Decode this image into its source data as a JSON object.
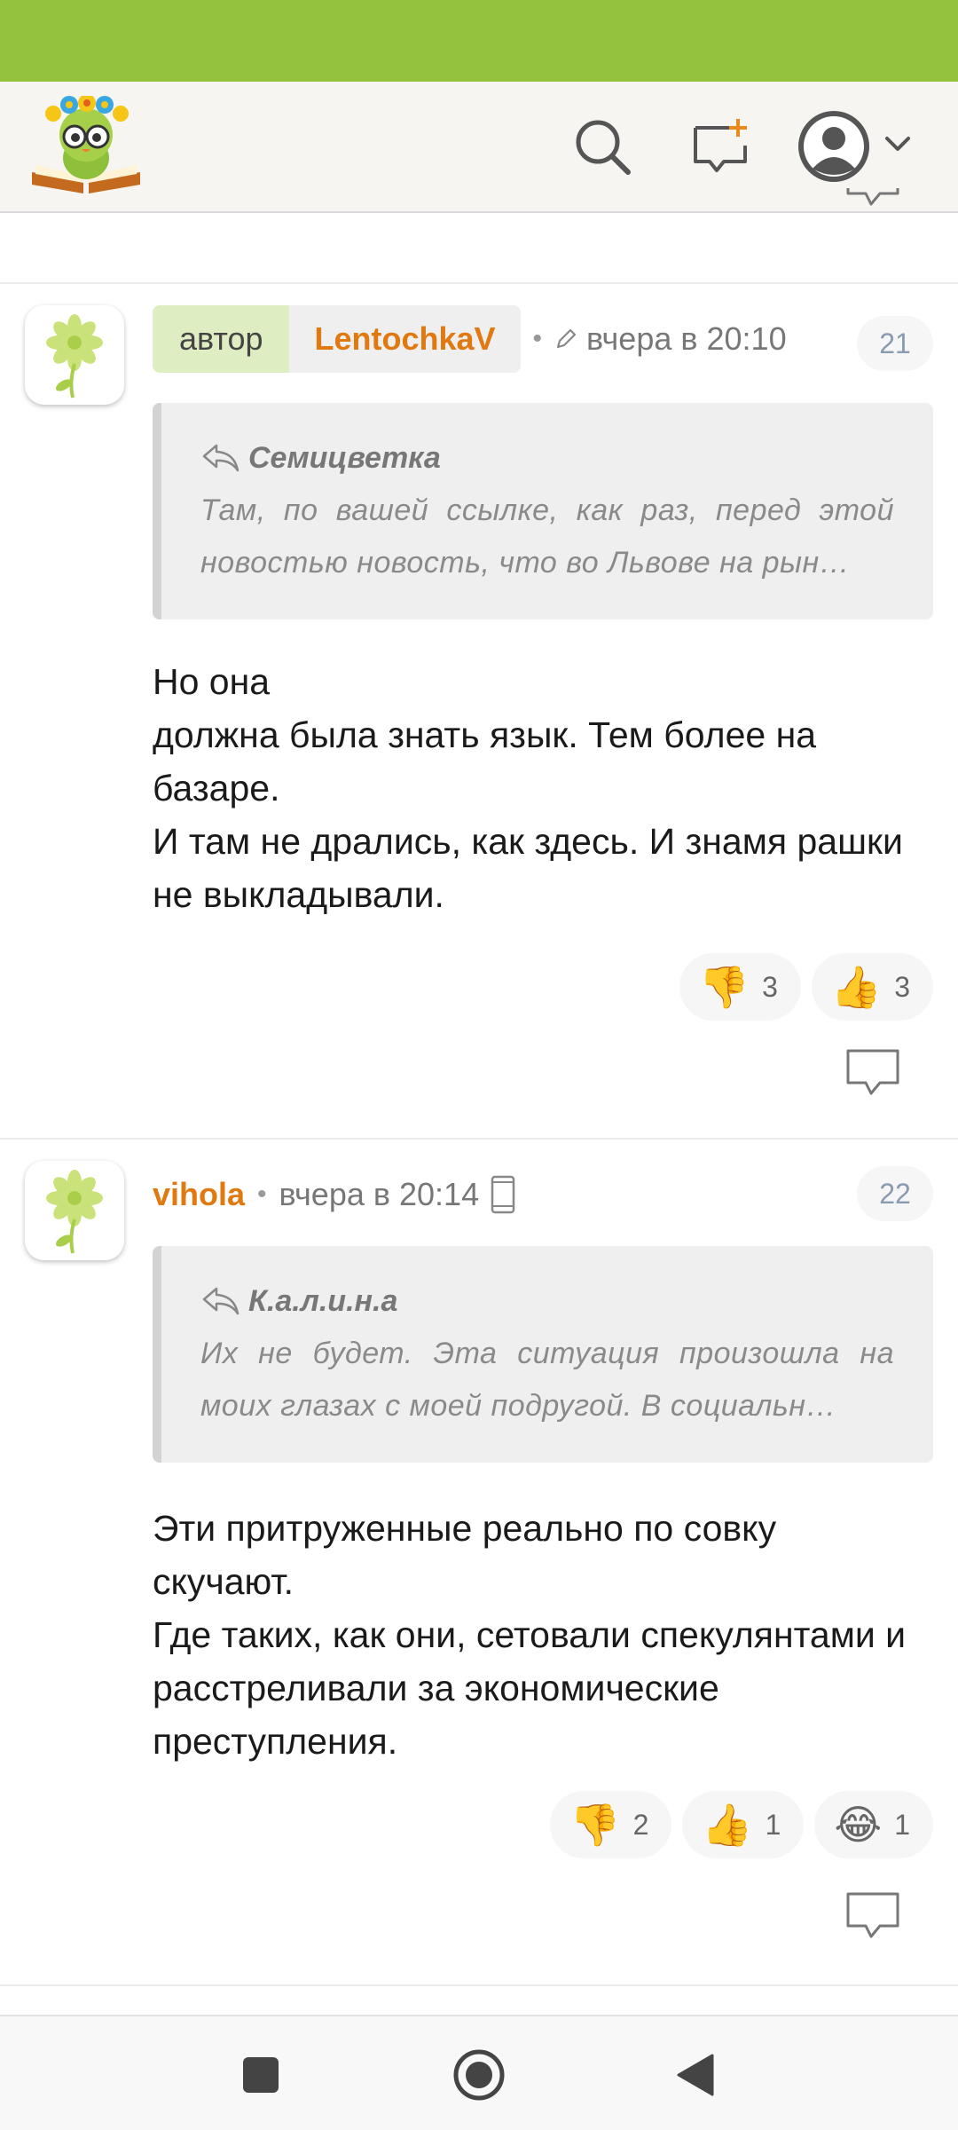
{
  "header": {
    "logo_icon": "reading-owl-logo",
    "search_icon": "search-icon",
    "compose_icon": "new-message-icon",
    "account_icon": "user-avatar-icon",
    "accent_color": "#95c23d",
    "username_color": "#e07a10"
  },
  "comments": [
    {
      "author_label": "автор",
      "author_name": "LentochkaV",
      "separator": "•",
      "time": "вчера в 20:10",
      "edited": true,
      "number": "21",
      "quote_author": "Семицветка",
      "quote_text": "Там, по вашей ссылке, как раз, перед этой новостью новость, что во Львове на рын…",
      "text": "Но она\nдолжна была знать язык. Тем более на базаре.\nИ там не дрались, как здесь. И знамя рашки не выкладывали.",
      "reactions": [
        {
          "emoji": "👎",
          "icon": "thumbs-down-icon",
          "count": "3"
        },
        {
          "emoji": "👍",
          "icon": "thumbs-up-icon",
          "count": "3"
        }
      ]
    },
    {
      "author_name": "vihola",
      "separator": "•",
      "time": "вчера в 20:14",
      "device": "mobile",
      "number": "22",
      "quote_author": "К.а.л.и.н.а",
      "quote_text": "Их не будет. Эта ситуация произошла на моих глазах с моей подругой. В социальн…",
      "text": "Эти притруженные реально по совку скучают.\nГде таких, как они, сетовали спекулянтами и расстреливали за экономические преступления.",
      "reactions": [
        {
          "emoji": "👎",
          "icon": "thumbs-down-icon",
          "count": "2"
        },
        {
          "emoji": "👍",
          "icon": "thumbs-up-icon",
          "count": "1"
        },
        {
          "emoji": "😂",
          "icon": "laughing-icon",
          "count": "1"
        }
      ]
    }
  ],
  "navbar": {
    "recents_icon": "square-recents-icon",
    "home_icon": "circle-home-icon",
    "back_icon": "triangle-back-icon"
  }
}
